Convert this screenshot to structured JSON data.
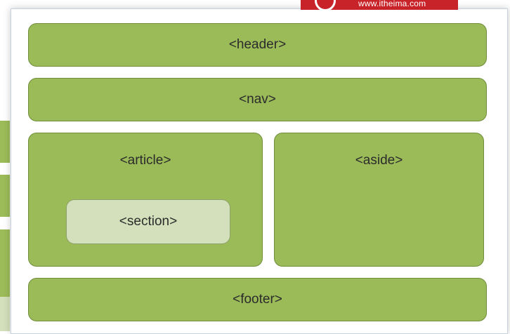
{
  "logo": {
    "text": "www.itheima.com"
  },
  "diagram": {
    "header": "<header>",
    "nav": "<nav>",
    "article": "<article>",
    "section": "<section>",
    "aside": "<aside>",
    "footer": "<footer>"
  }
}
